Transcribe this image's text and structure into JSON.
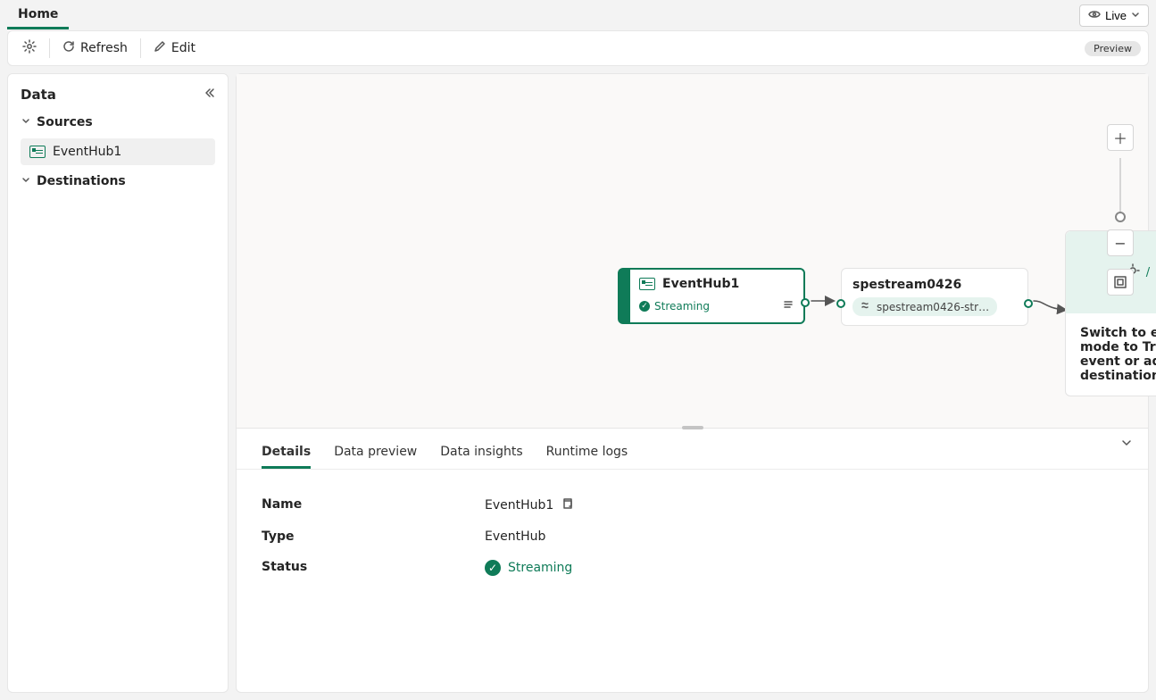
{
  "tabs": {
    "home": "Home"
  },
  "live": {
    "label": "Live"
  },
  "toolbar": {
    "refresh": "Refresh",
    "edit": "Edit",
    "preview": "Preview"
  },
  "sidebar": {
    "title": "Data",
    "sections": {
      "sources": "Sources",
      "destinations": "Destinations"
    },
    "sources": [
      {
        "label": "EventHub1"
      }
    ]
  },
  "canvas": {
    "source": {
      "title": "EventHub1",
      "status": "Streaming"
    },
    "stream": {
      "title": "spestream0426",
      "chip": "spestream0426-str…"
    },
    "editMsg": "Switch to edit mode to Transform event or add destination"
  },
  "panelTabs": {
    "details": "Details",
    "preview": "Data preview",
    "insights": "Data insights",
    "runtime": "Runtime logs"
  },
  "details": {
    "nameK": "Name",
    "nameV": "EventHub1",
    "typeK": "Type",
    "typeV": "EventHub",
    "statusK": "Status",
    "statusV": "Streaming"
  }
}
